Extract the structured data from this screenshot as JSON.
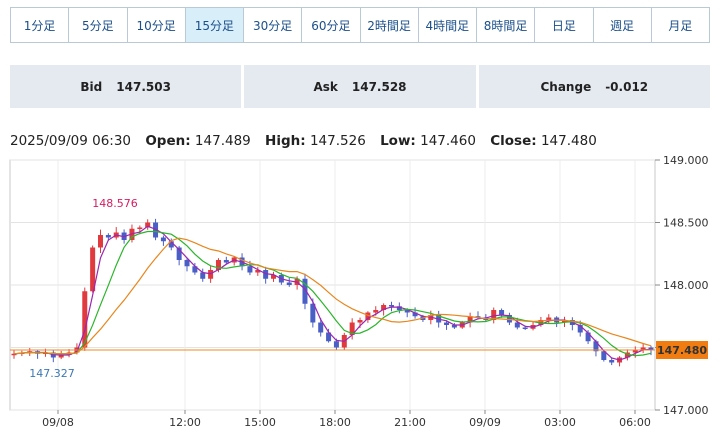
{
  "tabs": [
    {
      "label": "1分足",
      "active": false
    },
    {
      "label": "5分足",
      "active": false
    },
    {
      "label": "10分足",
      "active": false
    },
    {
      "label": "15分足",
      "active": true
    },
    {
      "label": "30分足",
      "active": false
    },
    {
      "label": "60分足",
      "active": false
    },
    {
      "label": "2時間足",
      "active": false
    },
    {
      "label": "4時間足",
      "active": false
    },
    {
      "label": "8時間足",
      "active": false
    },
    {
      "label": "日足",
      "active": false
    },
    {
      "label": "週足",
      "active": false
    },
    {
      "label": "月足",
      "active": false
    }
  ],
  "quote": {
    "bid_label": "Bid",
    "bid": "147.503",
    "ask_label": "Ask",
    "ask": "147.528",
    "change_label": "Change",
    "change": "-0.012"
  },
  "ohlc": {
    "datetime": "2025/09/09 06:30",
    "open_label": "Open:",
    "open": "147.489",
    "high_label": "High:",
    "high": "147.526",
    "low_label": "Low:",
    "low": "147.460",
    "close_label": "Close:",
    "close": "147.480"
  },
  "chart_data": {
    "type": "candlestick",
    "interval": "15分足",
    "ylim": [
      147.0,
      149.0
    ],
    "y_ticks": [
      "149.000",
      "148.500",
      "148.000",
      "147.500",
      "147.000"
    ],
    "x_ticks": [
      "09/08",
      "12:00",
      "15:00",
      "18:00",
      "21:00",
      "09/09",
      "03:00",
      "06:00"
    ],
    "grid": true,
    "last_price": "147.480",
    "high_annotation": "148.576",
    "low_annotation": "147.327",
    "colors": {
      "up": "#e0393e",
      "down": "#4a5fc6",
      "ma_fast": "#9b27b0",
      "ma_mid": "#2bb52b",
      "ma_slow": "#e8871e",
      "price_line": "#f08a24",
      "price_tag": "#f07c12",
      "high_label": "#d81b60",
      "low_label": "#3c78b5"
    },
    "close_path": [
      147.45,
      147.46,
      147.47,
      147.45,
      147.46,
      147.42,
      147.44,
      147.46,
      147.5,
      147.95,
      148.3,
      148.4,
      148.38,
      148.42,
      148.36,
      148.45,
      148.46,
      148.5,
      148.38,
      148.35,
      148.3,
      148.2,
      148.15,
      148.1,
      148.05,
      148.12,
      148.2,
      148.18,
      148.22,
      148.15,
      148.1,
      148.12,
      148.05,
      148.08,
      148.02,
      148.0,
      148.05,
      147.85,
      147.7,
      147.62,
      147.55,
      147.5,
      147.6,
      147.7,
      147.72,
      147.78,
      147.8,
      147.84,
      147.83,
      147.8,
      147.78,
      147.75,
      147.72,
      147.76,
      147.7,
      147.68,
      147.66,
      147.7,
      147.75,
      147.74,
      147.72,
      147.8,
      147.76,
      147.7,
      147.66,
      147.65,
      147.68,
      147.72,
      147.74,
      147.7,
      147.72,
      147.68,
      147.62,
      147.55,
      147.47,
      147.4,
      147.38,
      147.42,
      147.46,
      147.48,
      147.5,
      147.48
    ]
  }
}
